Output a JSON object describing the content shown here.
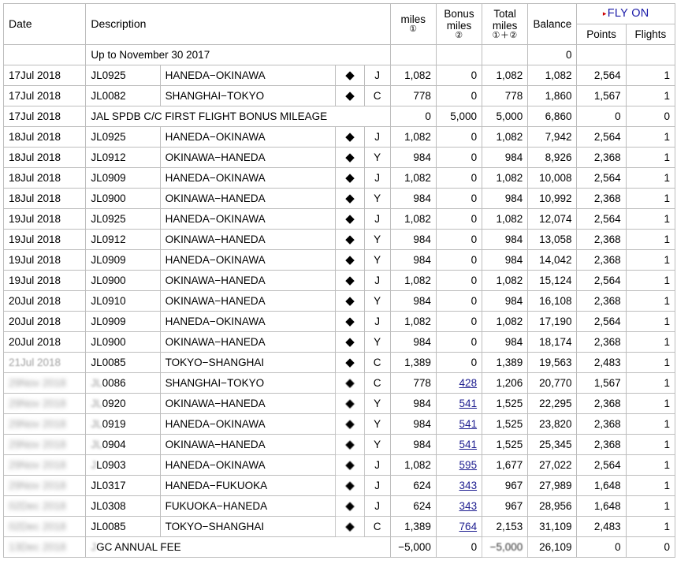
{
  "table": {
    "headers": {
      "date": "Date",
      "description": "Description",
      "miles": "miles",
      "miles_note": "①",
      "bonus_miles_l1": "Bonus",
      "bonus_miles_l2": "miles",
      "bonus_note": "②",
      "total_miles_l1": "Total",
      "total_miles_l2": "miles",
      "total_note": "①＋②",
      "balance": "Balance",
      "fly_on": "FLY ON",
      "fly_on_marker": "▸",
      "points": "Points",
      "flights": "Flights"
    },
    "opening_row": {
      "date": "",
      "description": "Up to November 30 2017",
      "miles": "",
      "bonus": "",
      "total": "",
      "balance": "0",
      "points": "",
      "flights": ""
    },
    "diamond_symbol": "◆",
    "rows": [
      {
        "date": "17Jul 2018",
        "date_masked": false,
        "flight": "JL0925",
        "route": "HANEDA−OKINAWA",
        "mark": "◆",
        "cls": "J",
        "miles": "1,082",
        "bonus": "0",
        "bonus_link": false,
        "total": "1,082",
        "balance": "1,082",
        "points": "2,564",
        "flights": "1"
      },
      {
        "date": "17Jul 2018",
        "date_masked": false,
        "flight": "JL0082",
        "route": "SHANGHAI−TOKYO",
        "mark": "◆",
        "cls": "C",
        "miles": "778",
        "bonus": "0",
        "bonus_link": false,
        "total": "778",
        "balance": "1,860",
        "points": "1,567",
        "flights": "1"
      },
      {
        "date": "17Jul 2018",
        "date_masked": false,
        "note": "JAL SPDB C/C FIRST FLIGHT BONUS MILEAGE",
        "miles": "0",
        "bonus": "5,000",
        "bonus_link": false,
        "total": "5,000",
        "balance": "6,860",
        "points": "0",
        "flights": "0"
      },
      {
        "date": "18Jul 2018",
        "date_masked": false,
        "flight": "JL0925",
        "route": "HANEDA−OKINAWA",
        "mark": "◆",
        "cls": "J",
        "miles": "1,082",
        "bonus": "0",
        "bonus_link": false,
        "total": "1,082",
        "balance": "7,942",
        "points": "2,564",
        "flights": "1"
      },
      {
        "date": "18Jul 2018",
        "date_masked": false,
        "flight": "JL0912",
        "route": "OKINAWA−HANEDA",
        "mark": "◆",
        "cls": "Y",
        "miles": "984",
        "bonus": "0",
        "bonus_link": false,
        "total": "984",
        "balance": "8,926",
        "points": "2,368",
        "flights": "1"
      },
      {
        "date": "18Jul 2018",
        "date_masked": false,
        "flight": "JL0909",
        "route": "HANEDA−OKINAWA",
        "mark": "◆",
        "cls": "J",
        "miles": "1,082",
        "bonus": "0",
        "bonus_link": false,
        "total": "1,082",
        "balance": "10,008",
        "points": "2,564",
        "flights": "1"
      },
      {
        "date": "18Jul 2018",
        "date_masked": false,
        "flight": "JL0900",
        "route": "OKINAWA−HANEDA",
        "mark": "◆",
        "cls": "Y",
        "miles": "984",
        "bonus": "0",
        "bonus_link": false,
        "total": "984",
        "balance": "10,992",
        "points": "2,368",
        "flights": "1"
      },
      {
        "date": "19Jul 2018",
        "date_masked": false,
        "flight": "JL0925",
        "route": "HANEDA−OKINAWA",
        "mark": "◆",
        "cls": "J",
        "miles": "1,082",
        "bonus": "0",
        "bonus_link": false,
        "total": "1,082",
        "balance": "12,074",
        "points": "2,564",
        "flights": "1"
      },
      {
        "date": "19Jul 2018",
        "date_masked": false,
        "flight": "JL0912",
        "route": "OKINAWA−HANEDA",
        "mark": "◆",
        "cls": "Y",
        "miles": "984",
        "bonus": "0",
        "bonus_link": false,
        "total": "984",
        "balance": "13,058",
        "points": "2,368",
        "flights": "1"
      },
      {
        "date": "19Jul 2018",
        "date_masked": false,
        "flight": "JL0909",
        "route": "HANEDA−OKINAWA",
        "mark": "◆",
        "cls": "Y",
        "miles": "984",
        "bonus": "0",
        "bonus_link": false,
        "total": "984",
        "balance": "14,042",
        "points": "2,368",
        "flights": "1"
      },
      {
        "date": "19Jul 2018",
        "date_masked": false,
        "flight": "JL0900",
        "route": "OKINAWA−HANEDA",
        "mark": "◆",
        "cls": "J",
        "miles": "1,082",
        "bonus": "0",
        "bonus_link": false,
        "total": "1,082",
        "balance": "15,124",
        "points": "2,564",
        "flights": "1"
      },
      {
        "date": "20Jul 2018",
        "date_masked": false,
        "flight": "JL0910",
        "route": "OKINAWA−HANEDA",
        "mark": "◆",
        "cls": "Y",
        "miles": "984",
        "bonus": "0",
        "bonus_link": false,
        "total": "984",
        "balance": "16,108",
        "points": "2,368",
        "flights": "1"
      },
      {
        "date": "20Jul 2018",
        "date_masked": false,
        "flight": "JL0909",
        "route": "HANEDA−OKINAWA",
        "mark": "◆",
        "cls": "J",
        "miles": "1,082",
        "bonus": "0",
        "bonus_link": false,
        "total": "1,082",
        "balance": "17,190",
        "points": "2,564",
        "flights": "1"
      },
      {
        "date": "20Jul 2018",
        "date_masked": false,
        "flight": "JL0900",
        "route": "OKINAWA−HANEDA",
        "mark": "◆",
        "cls": "Y",
        "miles": "984",
        "bonus": "0",
        "bonus_link": false,
        "total": "984",
        "balance": "18,174",
        "points": "2,368",
        "flights": "1"
      },
      {
        "date": "21Jul 2018",
        "date_masked": "light",
        "flight": "JL0085",
        "route": "TOKYO−SHANGHAI",
        "mark": "◆",
        "cls": "C",
        "miles": "1,389",
        "bonus": "0",
        "bonus_link": false,
        "total": "1,389",
        "balance": "19,563",
        "points": "2,483",
        "flights": "1"
      },
      {
        "date": "29Nov 2018",
        "date_masked": true,
        "flight": "JL0086",
        "flight_masked_prefix": "JL",
        "route": "SHANGHAI−TOKYO",
        "mark": "◆",
        "cls": "C",
        "miles": "778",
        "bonus": "428",
        "bonus_link": true,
        "total": "1,206",
        "balance": "20,770",
        "points": "1,567",
        "flights": "1"
      },
      {
        "date": "29Nov 2018",
        "date_masked": true,
        "flight": "JL0920",
        "flight_masked_prefix": "JL",
        "route": "OKINAWA−HANEDA",
        "mark": "◆",
        "cls": "Y",
        "miles": "984",
        "bonus": "541",
        "bonus_link": true,
        "total": "1,525",
        "balance": "22,295",
        "points": "2,368",
        "flights": "1"
      },
      {
        "date": "29Nov 2018",
        "date_masked": true,
        "flight": "JL0919",
        "flight_masked_prefix": "JL",
        "route": "HANEDA−OKINAWA",
        "mark": "◆",
        "cls": "Y",
        "miles": "984",
        "bonus": "541",
        "bonus_link": true,
        "total": "1,525",
        "balance": "23,820",
        "points": "2,368",
        "flights": "1"
      },
      {
        "date": "29Nov 2018",
        "date_masked": true,
        "flight": "JL0904",
        "flight_masked_prefix": "JL",
        "route": "OKINAWA−HANEDA",
        "mark": "◆",
        "cls": "Y",
        "miles": "984",
        "bonus": "541",
        "bonus_link": true,
        "total": "1,525",
        "balance": "25,345",
        "points": "2,368",
        "flights": "1"
      },
      {
        "date": "29Nov 2018",
        "date_masked": true,
        "flight": "JL0903",
        "flight_masked_prefix": "J",
        "route": "HANEDA−OKINAWA",
        "mark": "◆",
        "cls": "J",
        "miles": "1,082",
        "bonus": "595",
        "bonus_link": true,
        "total": "1,677",
        "balance": "27,022",
        "points": "2,564",
        "flights": "1"
      },
      {
        "date": "29Nov 2018",
        "date_masked": true,
        "flight": "JL0317",
        "route": "HANEDA−FUKUOKA",
        "mark": "◆",
        "cls": "J",
        "miles": "624",
        "bonus": "343",
        "bonus_link": true,
        "total": "967",
        "balance": "27,989",
        "points": "1,648",
        "flights": "1"
      },
      {
        "date": "02Dec 2018",
        "date_masked": true,
        "flight": "JL0308",
        "route": "FUKUOKA−HANEDA",
        "mark": "◆",
        "cls": "J",
        "miles": "624",
        "bonus": "343",
        "bonus_link": true,
        "total": "967",
        "balance": "28,956",
        "points": "1,648",
        "flights": "1"
      },
      {
        "date": "02Dec 2018",
        "date_masked": true,
        "flight": "JL0085",
        "route": "TOKYO−SHANGHAI",
        "mark": "◆",
        "cls": "C",
        "miles": "1,389",
        "bonus": "764",
        "bonus_link": true,
        "total": "2,153",
        "balance": "31,109",
        "points": "2,483",
        "flights": "1"
      },
      {
        "date": "13Dec 2018",
        "date_masked": true,
        "note": "JGC ANNUAL FEE",
        "note_masked_prefix": "J",
        "miles": "−5,000",
        "bonus": "0",
        "bonus_link": false,
        "total": "−5,000",
        "total_soft": true,
        "balance": "26,109",
        "points": "0",
        "flights": "0"
      }
    ]
  }
}
